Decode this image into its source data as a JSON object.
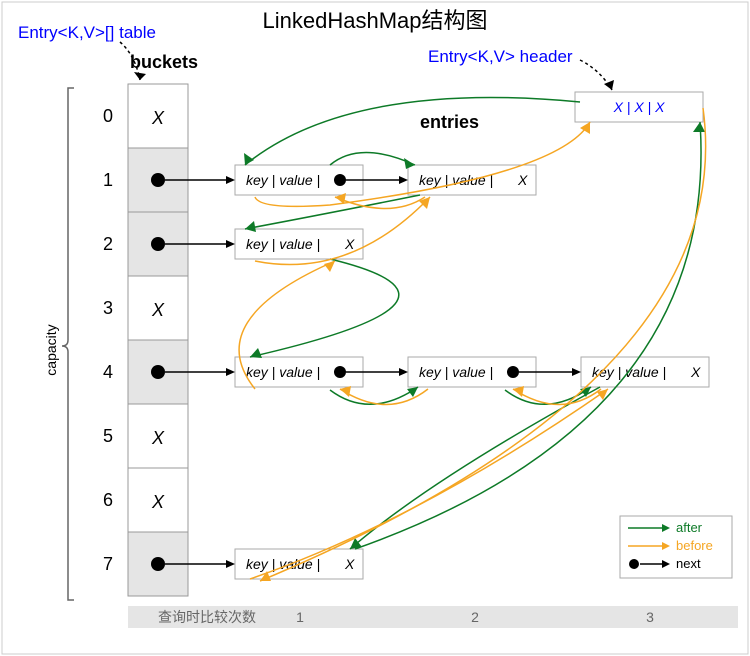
{
  "title": "LinkedHashMap结构图",
  "labels": {
    "table": "Entry<K,V>[] table",
    "buckets": "buckets",
    "header": "Entry<K,V> header",
    "entries": "entries",
    "capacity": "capacity",
    "bottom_caption": "查询时比较次数",
    "bottom_counts": [
      "1",
      "2",
      "3"
    ]
  },
  "bucket_indices": [
    "0",
    "1",
    "2",
    "3",
    "4",
    "5",
    "6",
    "7"
  ],
  "bucket_filled": [
    false,
    true,
    true,
    false,
    true,
    false,
    false,
    true
  ],
  "entry_label": "key | value |",
  "entry_x": "X",
  "header_cell": "X  |  X  |  X",
  "legend": {
    "after": "after",
    "before": "before",
    "next": "next"
  },
  "chart_data": {
    "type": "table",
    "description": "LinkedHashMap internal structure: bucket array of capacity 8 with collision chains (next pointers) and doubly-linked insertion-order list (after/before pointers) threaded through all entries, anchored at a header node.",
    "capacity": 8,
    "buckets": [
      {
        "index": 0,
        "entries": []
      },
      {
        "index": 1,
        "entries": [
          {
            "id": "e1a",
            "next": "e1b"
          },
          {
            "id": "e1b",
            "next": null
          }
        ]
      },
      {
        "index": 2,
        "entries": [
          {
            "id": "e2a",
            "next": null
          }
        ]
      },
      {
        "index": 3,
        "entries": []
      },
      {
        "index": 4,
        "entries": [
          {
            "id": "e4a",
            "next": "e4b"
          },
          {
            "id": "e4b",
            "next": "e4c"
          },
          {
            "id": "e4c",
            "next": null
          }
        ]
      },
      {
        "index": 5,
        "entries": []
      },
      {
        "index": 6,
        "entries": []
      },
      {
        "index": 7,
        "entries": [
          {
            "id": "e7a",
            "next": null
          }
        ]
      }
    ],
    "header_node": "header",
    "insertion_order_after_chain": [
      "header",
      "e1a",
      "e1b",
      "e2a",
      "e4a",
      "e4b",
      "e4c",
      "e7a",
      "header"
    ],
    "lookup_comparison_counts": {
      "column1": 1,
      "column2": 2,
      "column3": 3
    },
    "pointer_legend": {
      "after": "green",
      "before": "orange",
      "next": "black"
    }
  }
}
